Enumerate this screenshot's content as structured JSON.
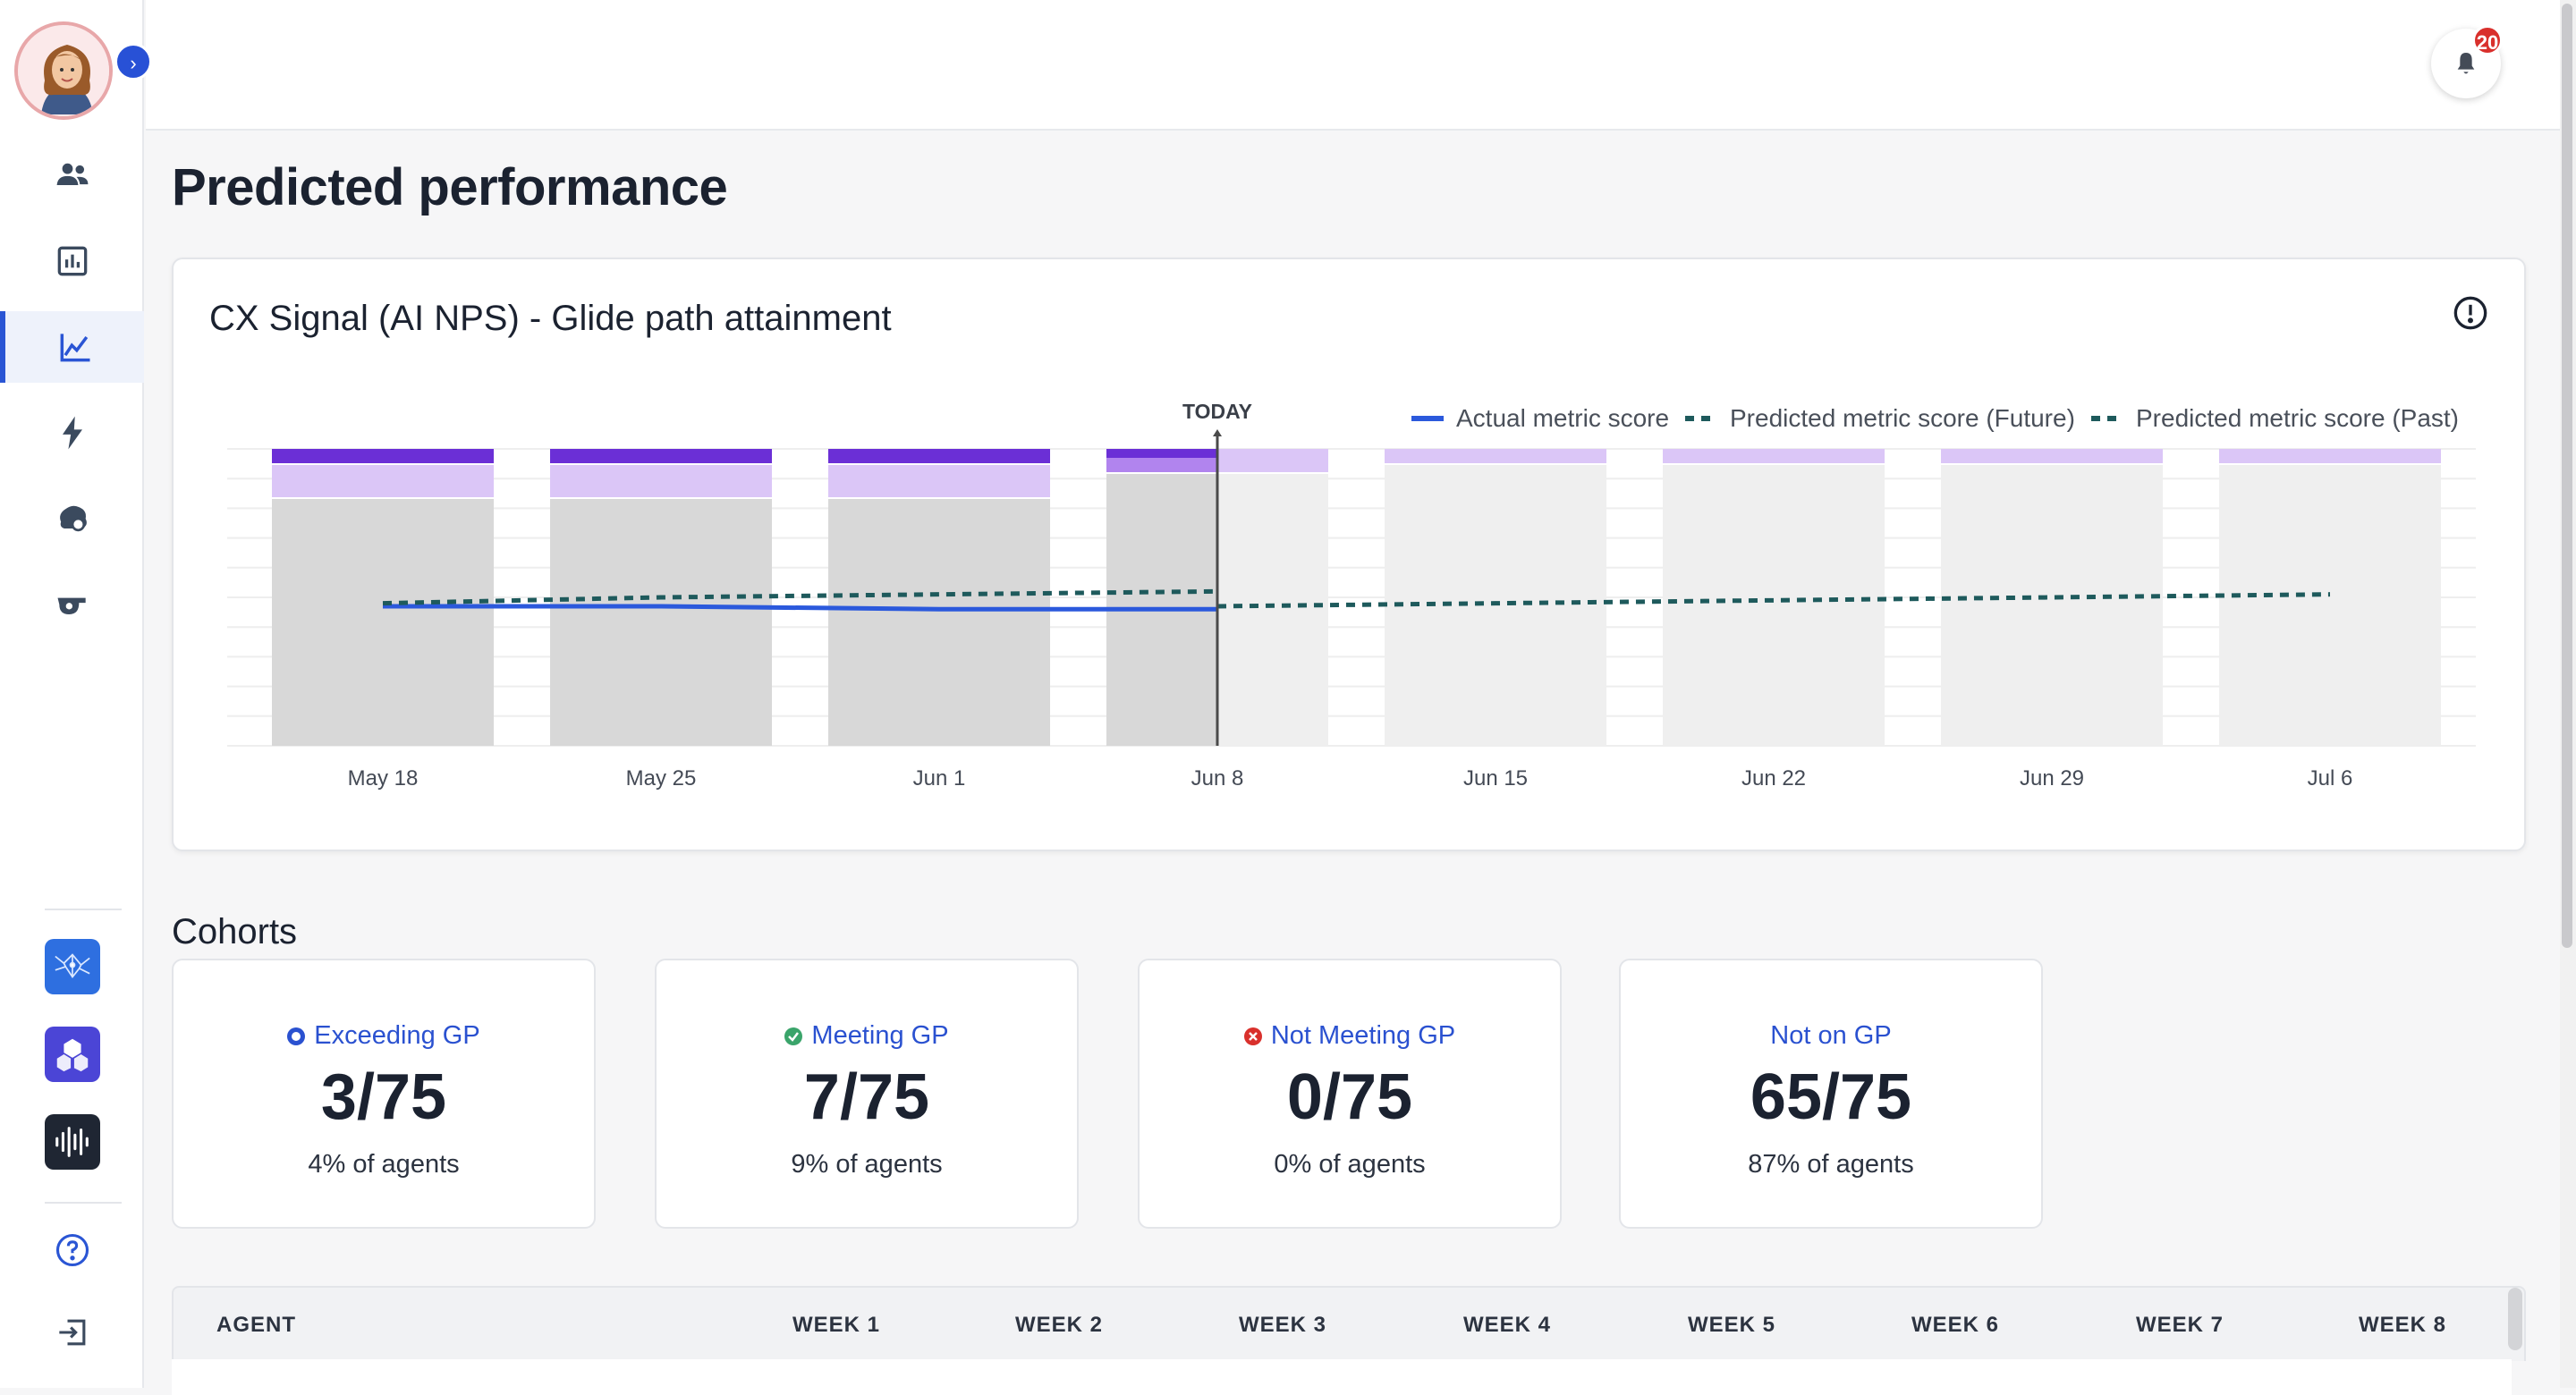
{
  "sidebar": {
    "expand_label": "›",
    "items": [
      {
        "name": "team-icon"
      },
      {
        "name": "report-icon"
      },
      {
        "name": "trend-chart-icon",
        "active": true
      },
      {
        "name": "lightning-icon"
      },
      {
        "name": "brain-icon"
      },
      {
        "name": "whistle-icon"
      }
    ],
    "apps": [
      "network-app-icon",
      "hexagon-app-icon",
      "audio-wave-app-icon"
    ],
    "bottom": [
      "help-icon",
      "logout-icon"
    ]
  },
  "topbar": {
    "notification_count": "20"
  },
  "page": {
    "title": "Predicted performance"
  },
  "chart": {
    "title": "CX Signal (AI NPS) - Glide path attainment",
    "today_label": "TODAY",
    "legend": {
      "actual": "Actual metric score",
      "future": "Predicted metric score (Future)",
      "past": "Predicted metric score (Past)"
    }
  },
  "chart_data": {
    "type": "bar",
    "categories": [
      "May 18",
      "May 25",
      "Jun 1",
      "Jun 8",
      "Jun 15",
      "Jun 22",
      "Jun 29",
      "Jul 6"
    ],
    "today_index": 3,
    "series": [
      {
        "name": "Actual metric score",
        "kind": "line",
        "values": [
          0.47,
          0.47,
          0.46,
          0.46,
          null,
          null,
          null,
          null
        ]
      },
      {
        "name": "Predicted metric score (Future)",
        "kind": "dashed-line",
        "values": [
          null,
          null,
          null,
          0.47,
          0.48,
          0.49,
          0.5,
          0.51
        ]
      },
      {
        "name": "Predicted metric score (Past)",
        "kind": "dashed-line",
        "values": [
          0.48,
          0.5,
          0.51,
          0.52,
          null,
          null,
          null,
          null
        ]
      }
    ],
    "colors": {
      "actual": "#2b59dc",
      "predicted": "#1e5a5c",
      "bar_past": "#d8d8d8",
      "bar_future": "#efefef",
      "band_dark": "#6b2fd6",
      "band_mid": "#b184ee",
      "band_light": "#dbc6f7"
    }
  },
  "cohorts": {
    "title": "Cohorts",
    "cards": [
      {
        "label": "Exceeding GP",
        "value": "3/75",
        "sub": "4% of agents",
        "icon": "star-badge-icon",
        "color": "#2a51d0"
      },
      {
        "label": "Meeting GP",
        "value": "7/75",
        "sub": "9% of agents",
        "icon": "check-circle-icon",
        "color": "#3aa46a"
      },
      {
        "label": "Not Meeting GP",
        "value": "0/75",
        "sub": "0% of agents",
        "icon": "x-circle-icon",
        "color": "#d9302c"
      },
      {
        "label": "Not on GP",
        "value": "65/75",
        "sub": "87% of agents",
        "icon": "",
        "color": ""
      }
    ]
  },
  "table": {
    "columns": [
      "AGENT",
      "WEEK 1",
      "WEEK 2",
      "WEEK 3",
      "WEEK 4",
      "WEEK 5",
      "WEEK 6",
      "WEEK 7",
      "WEEK 8"
    ]
  }
}
